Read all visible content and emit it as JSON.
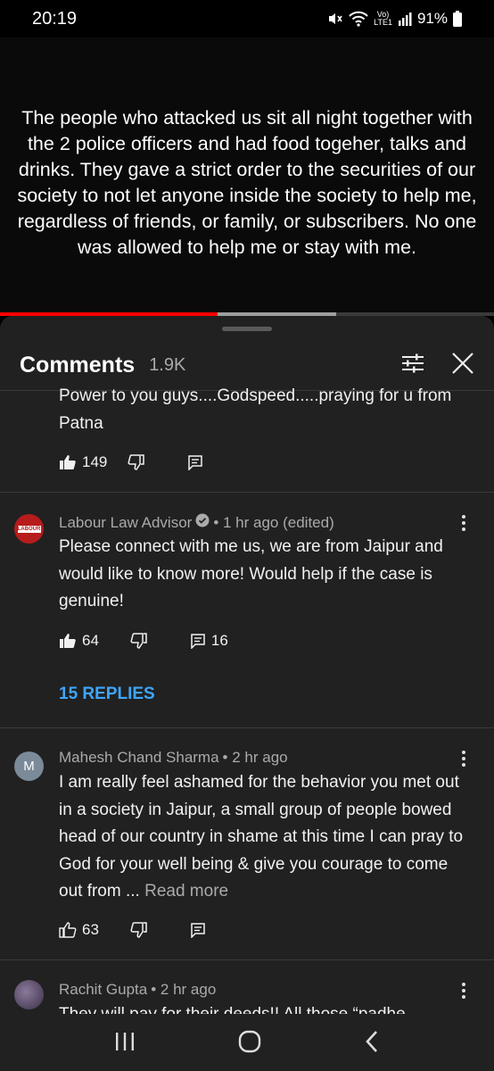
{
  "status_bar": {
    "time": "20:19",
    "volte_top": "Vo)",
    "volte_bottom": "LTE1",
    "battery": "91%",
    "icons": [
      "mute-icon",
      "wifi-icon",
      "signal-icon",
      "battery-icon"
    ]
  },
  "video": {
    "caption": "The people who attacked us sit all night together with the 2 police officers and had food togeher, talks and drinks. They gave a strict order to the securities of our society to not let anyone inside the society to help me, regardless of friends, or family, or subscribers. No one was allowed to help me or stay with me.",
    "progress_played": 0.44,
    "progress_buffered": 0.68
  },
  "comments_panel": {
    "title": "Comments",
    "count": "1.9K",
    "icons": [
      "filter-icon",
      "close-icon"
    ]
  },
  "comments": [
    {
      "text": "Power to you guys....Godspeed.....praying for u from Patna",
      "likes": "149",
      "replies_count": ""
    },
    {
      "author": "Labour Law Advisor",
      "avatar_text": "LABOUR",
      "verified": true,
      "time": "• 1 hr ago (edited)",
      "text": "Please connect with me us, we are from Jaipur and would like to know more! Would help if the case is genuine!",
      "likes": "64",
      "replies_count": "16",
      "replies_link": "15 REPLIES"
    },
    {
      "author": "Mahesh Chand Sharma",
      "avatar_text": "M",
      "time": "• 2 hr ago",
      "text": "I am really feel ashamed  for the behavior you met out in a society in Jaipur, a small group of people bowed head of our country in shame at this time I can  pray to God for your well being & give you courage to come out from ...",
      "read_more": "Read more",
      "likes": "63",
      "replies_count": ""
    },
    {
      "author": "Rachit Gupta",
      "time": "• 2 hr ago",
      "text": "They will pay for their deeds!! All those “padhe"
    }
  ],
  "colors": {
    "panel_bg": "#212121",
    "accent_blue": "#3ea6ff",
    "progress_red": "#ff0000",
    "avatar_m": "#7a8a99",
    "avatar_labour": "#b71c1c"
  },
  "nav_bar": {
    "icons": [
      "recent-apps-icon",
      "home-icon",
      "back-icon"
    ]
  }
}
